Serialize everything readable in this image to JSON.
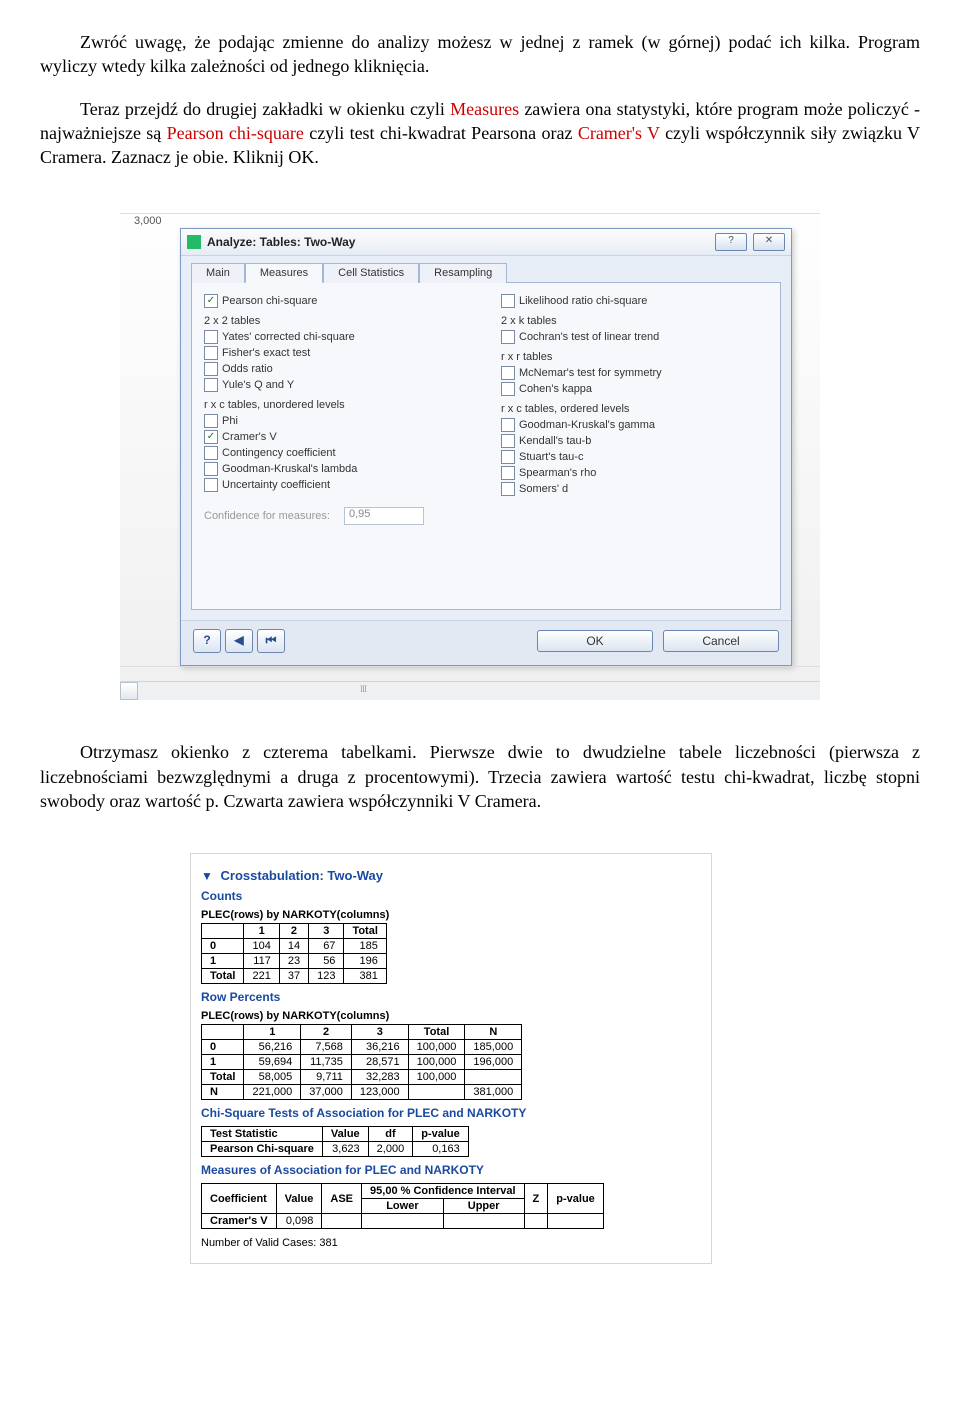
{
  "para1_pre": "Zwróć uwagę, że podając zmienne do analizy możesz w jednej z ramek (w górnej) podać ich kilka. Program wyliczy wtedy kilka zależności od jednego kliknięcia.",
  "para2_a": "Teraz przejdź do drugiej zakładki w okienku czyli ",
  "para2_m": "Measures",
  "para2_b": "  zawiera ona statystyki, które program może policzyć  -  najważniejsze są ",
  "para2_p": "Pearson chi-square",
  "para2_c": " czyli test chi-kwadrat Pearsona oraz ",
  "para2_v": "Cramer's V",
  "para2_d": " czyli współczynnik siły związku V Cramera. Zaznacz je obie. Kliknij OK.",
  "para3": "Otrzymasz okienko z czterema tabelkami. Pierwsze dwie to dwudzielne tabele liczebności (pierwsza z liczebnościami bezwzględnymi a druga z procentowymi). Trzecia zawiera wartość testu chi-kwadrat, liczbę stopni swobody oraz wartość p. Czwarta zawiera współczynniki V Cramera.",
  "bg_rows": [
    "3,000"
  ],
  "dialog": {
    "title": "Analyze: Tables: Two-Way",
    "help_glyph": "?",
    "close_glyph": "✕",
    "tabs": [
      "Main",
      "Measures",
      "Cell Statistics",
      "Resampling"
    ],
    "left": {
      "items1": [
        {
          "label": "Pearson chi-square",
          "checked": true
        }
      ],
      "group2_head": "2 x 2 tables",
      "items2": [
        {
          "label": "Yates' corrected chi-square",
          "checked": false
        },
        {
          "label": "Fisher's exact test",
          "checked": false
        },
        {
          "label": "Odds ratio",
          "checked": false
        },
        {
          "label": "Yule's Q and Y",
          "checked": false
        }
      ],
      "group3_head": "r x c tables, unordered levels",
      "items3": [
        {
          "label": "Phi",
          "checked": false
        },
        {
          "label": "Cramer's V",
          "checked": true
        },
        {
          "label": "Contingency coefficient",
          "checked": false
        },
        {
          "label": "Goodman-Kruskal's lambda",
          "checked": false
        },
        {
          "label": "Uncertainty coefficient",
          "checked": false
        }
      ]
    },
    "right": {
      "items1": [
        {
          "label": "Likelihood ratio chi-square",
          "checked": false
        }
      ],
      "group2_head": "2 x k tables",
      "items2": [
        {
          "label": "Cochran's test of linear trend",
          "checked": false
        }
      ],
      "group3_head": "r x r tables",
      "items3": [
        {
          "label": "McNemar's test for symmetry",
          "checked": false
        },
        {
          "label": "Cohen's kappa",
          "checked": false
        }
      ],
      "group4_head": "r x c tables, ordered levels",
      "items4": [
        {
          "label": "Goodman-Kruskal's gamma",
          "checked": false
        },
        {
          "label": "Kendall's tau-b",
          "checked": false
        },
        {
          "label": "Stuart's tau-c",
          "checked": false
        },
        {
          "label": "Spearman's rho",
          "checked": false
        },
        {
          "label": "Somers' d",
          "checked": false
        }
      ]
    },
    "conf_label": "Confidence for measures:",
    "conf_value": "0,95",
    "nav": {
      "help": "?",
      "back1": "◀",
      "back2": "⏮"
    },
    "ok": "OK",
    "cancel": "Cancel"
  },
  "results": {
    "title": "Crosstabulation: Two-Way",
    "counts_heading": "Counts",
    "subhead": "PLEC(rows) by NARKOTY(columns)",
    "counts": {
      "cols": [
        "",
        "1",
        "2",
        "3",
        "Total"
      ],
      "rows": [
        [
          "0",
          "104",
          "14",
          "67",
          "185"
        ],
        [
          "1",
          "117",
          "23",
          "56",
          "196"
        ],
        [
          "Total",
          "221",
          "37",
          "123",
          "381"
        ]
      ]
    },
    "rowpct_heading": "Row Percents",
    "rowpct": {
      "cols": [
        "",
        "1",
        "2",
        "3",
        "Total",
        "N"
      ],
      "rows": [
        [
          "0",
          "56,216",
          "7,568",
          "36,216",
          "100,000",
          "185,000"
        ],
        [
          "1",
          "59,694",
          "11,735",
          "28,571",
          "100,000",
          "196,000"
        ],
        [
          "Total",
          "58,005",
          "9,711",
          "32,283",
          "100,000",
          ""
        ],
        [
          "N",
          "221,000",
          "37,000",
          "123,000",
          "",
          "381,000"
        ]
      ]
    },
    "chi_heading": "Chi-Square Tests of Association for PLEC and NARKOTY",
    "chi": {
      "cols": [
        "Test Statistic",
        "Value",
        "df",
        "p-value"
      ],
      "rows": [
        [
          "Pearson Chi-square",
          "3,623",
          "2,000",
          "0,163"
        ]
      ]
    },
    "meas_heading": "Measures of Association for PLEC and NARKOTY",
    "meas": {
      "top_cols": [
        "Coefficient",
        "Value",
        "ASE",
        "95,00 % Confidence Interval",
        "Z",
        "p-value"
      ],
      "sub_cols": [
        "Lower",
        "Upper"
      ],
      "rows": [
        [
          "Cramer's V",
          "0,098",
          "",
          "",
          "",
          "",
          ""
        ]
      ]
    },
    "valid": "Number of Valid Cases: 381"
  }
}
